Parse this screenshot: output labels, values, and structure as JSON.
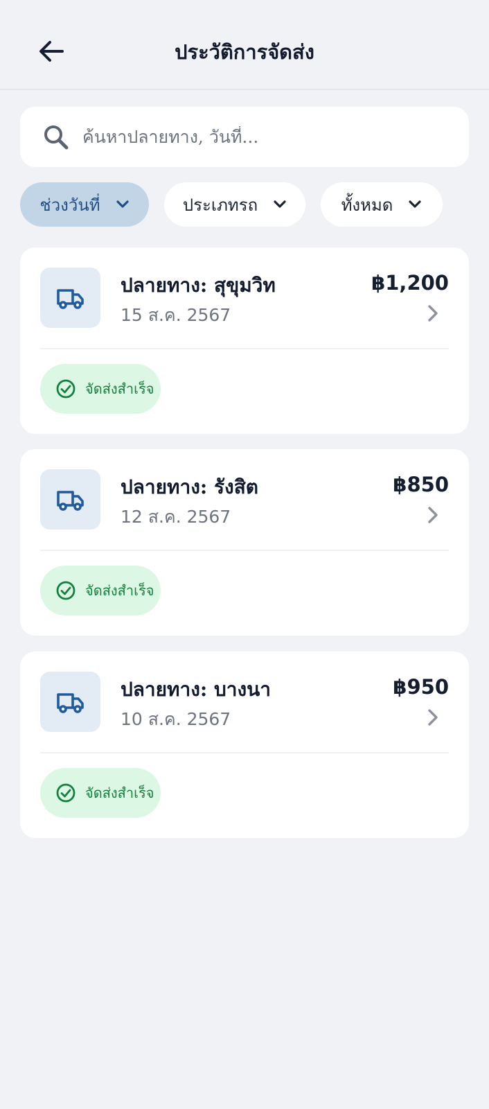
{
  "header": {
    "title": "ประวัติการจัดส่ง",
    "back_icon": "arrow-left-icon"
  },
  "search": {
    "placeholder": "ค้นหาปลายทาง, วันที่..."
  },
  "filters": [
    {
      "label": "ช่วงวันที่",
      "active": true
    },
    {
      "label": "ประเภทรถ",
      "active": false
    },
    {
      "label": "ทั้งหมด",
      "active": false
    }
  ],
  "deliveries": [
    {
      "destination": "ปลายทาง: สุขุมวิท",
      "date": "15 ส.ค. 2567",
      "price": "฿1,200",
      "status": "จัดส่งสำเร็จ"
    },
    {
      "destination": "ปลายทาง: รังสิต",
      "date": "12 ส.ค. 2567",
      "price": "฿850",
      "status": "จัดส่งสำเร็จ"
    },
    {
      "destination": "ปลายทาง: บางนา",
      "date": "10 ส.ค. 2567",
      "price": "฿950",
      "status": "จัดส่งสำเร็จ"
    }
  ],
  "colors": {
    "accent": "#1f5b9e",
    "background": "#f0f2f6",
    "active_chip": "#c2d5e6",
    "success_bg": "#dcf8e5",
    "success_text": "#14803d"
  }
}
